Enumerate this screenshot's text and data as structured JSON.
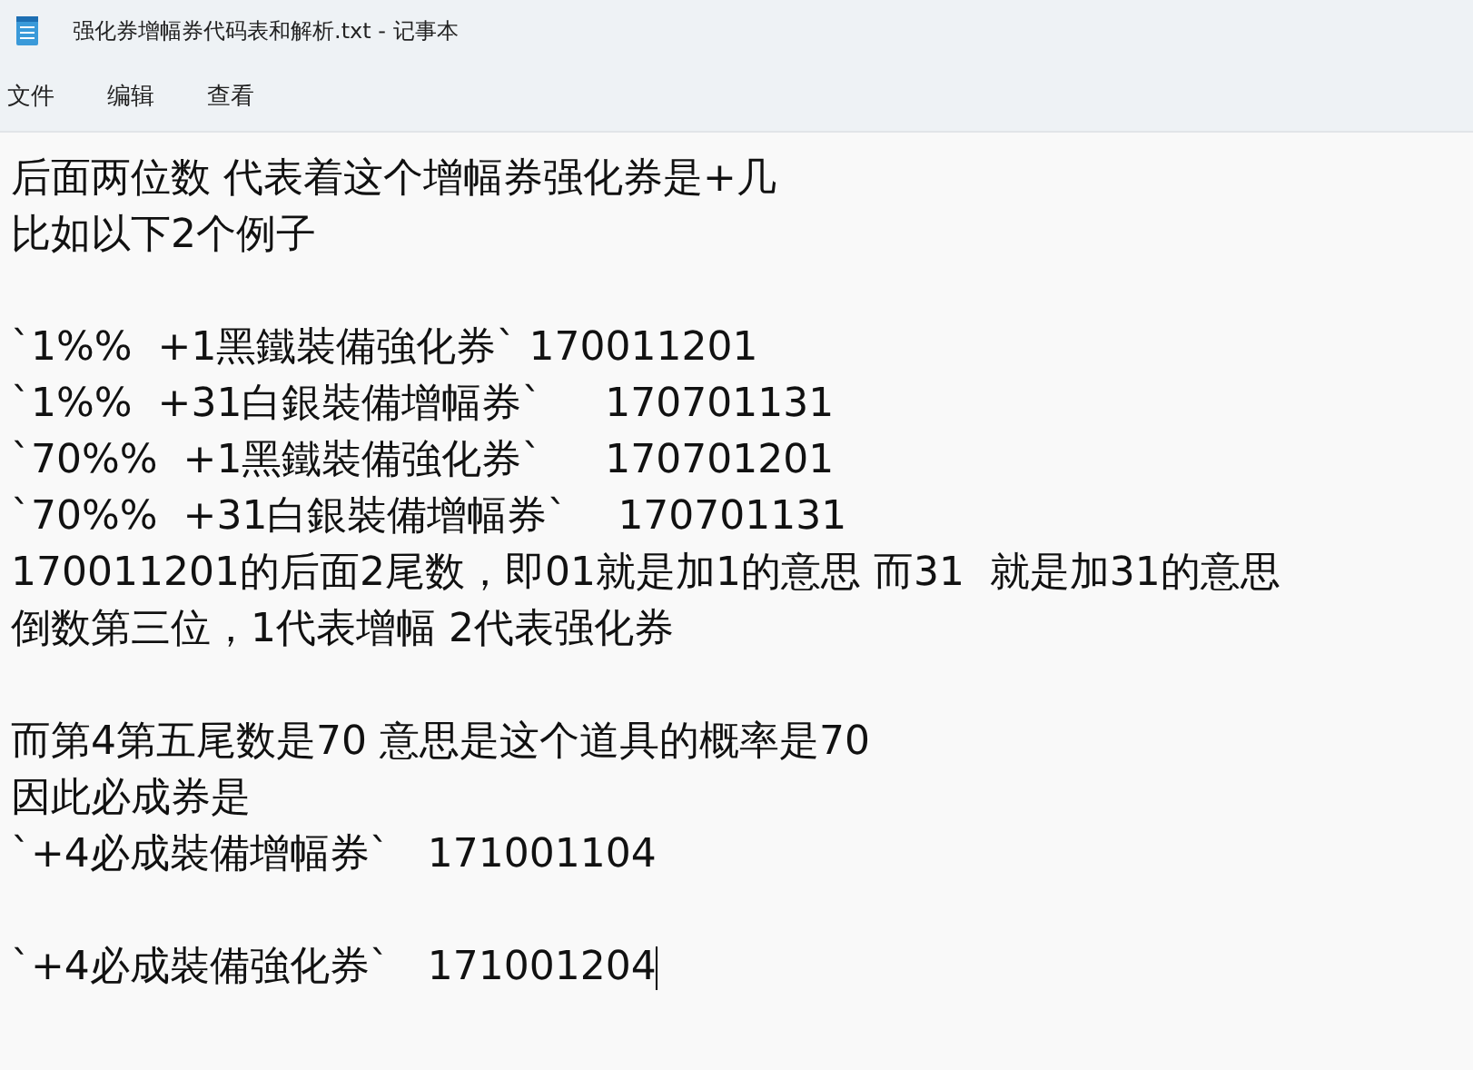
{
  "window": {
    "title": "强化券增幅券代码表和解析.txt - 记事本"
  },
  "menu": [
    "文件",
    "编辑",
    "查看"
  ],
  "editor": {
    "blocks": [
      [
        "后面两位数 代表着这个增幅券强化券是+几",
        "比如以下2个例子"
      ],
      [
        "`1%%  +1黑鐵裝備強化券` 170011201",
        "`1%%  +31白銀裝備增幅券`     170701131",
        "`70%%  +1黑鐵裝備強化券`     170701201",
        "`70%%  +31白銀裝備增幅券`    170701131",
        "170011201的后面2尾数，即01就是加1的意思 而31  就是加31的意思",
        "倒数第三位，1代表增幅 2代表强化券"
      ],
      [
        "而第4第五尾数是70 意思是这个道具的概率是70",
        "因此必成券是",
        "`+4必成裝備增幅券`   171001104"
      ],
      [
        "`+4必成裝備強化券`   171001204"
      ]
    ]
  }
}
